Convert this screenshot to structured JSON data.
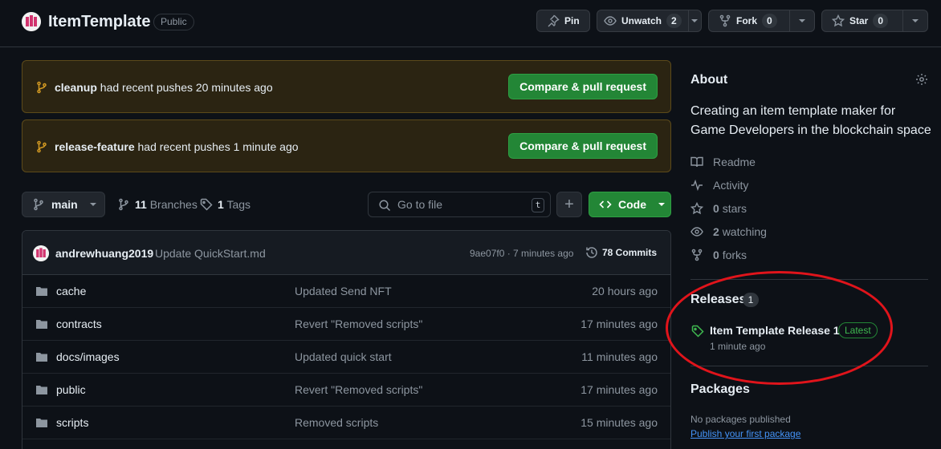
{
  "repo": {
    "name": "ItemTemplate",
    "visibility": "Public"
  },
  "header_actions": {
    "pin_label": "Pin",
    "unwatch_label": "Unwatch",
    "watch_count": "2",
    "fork_label": "Fork",
    "fork_count": "0",
    "star_label": "Star",
    "star_count": "0"
  },
  "banners": [
    {
      "branch": "cleanup",
      "text": "had recent pushes 20 minutes ago",
      "button": "Compare & pull request"
    },
    {
      "branch": "release-feature",
      "text": "had recent pushes 1 minute ago",
      "button": "Compare & pull request"
    }
  ],
  "toolbar": {
    "branch": "main",
    "branches_count": "11",
    "branches_label": "Branches",
    "tags_count": "1",
    "tags_label": "Tags",
    "search_placeholder": "Go to file",
    "search_shortcut": "t",
    "add_label": "+",
    "code_label": "Code"
  },
  "latest_commit": {
    "author": "andrewhuang2019",
    "message": "Update QuickStart.md",
    "hash_time": "9ae07f0 · 7 minutes ago",
    "commits_count": "78 Commits"
  },
  "files": [
    {
      "name": "cache",
      "message": "Updated Send NFT",
      "age": "20 hours ago"
    },
    {
      "name": "contracts",
      "message": "Revert \"Removed scripts\"",
      "age": "17 minutes ago"
    },
    {
      "name": "docs/images",
      "message": "Updated quick start",
      "age": "11 minutes ago"
    },
    {
      "name": "public",
      "message": "Revert \"Removed scripts\"",
      "age": "17 minutes ago"
    },
    {
      "name": "scripts",
      "message": "Removed scripts",
      "age": "15 minutes ago"
    }
  ],
  "about": {
    "title": "About",
    "description": "Creating an item template maker for Game Developers in the blockchain space",
    "readme": "Readme",
    "activity": "Activity",
    "stars_count": "0",
    "stars_label": "stars",
    "watching_count": "2",
    "watching_label": "watching",
    "forks_count": "0",
    "forks_label": "forks"
  },
  "releases": {
    "title": "Releases",
    "count": "1",
    "latest_name": "Item Template Release 1",
    "latest_badge": "Latest",
    "latest_time": "1 minute ago"
  },
  "packages": {
    "title": "Packages",
    "none_text": "No packages published",
    "publish_link": "Publish your first package"
  },
  "colors": {
    "background": "#0d1117",
    "accent_green": "#238636",
    "link_blue": "#4493f8",
    "annotation_red": "#e0141b"
  }
}
